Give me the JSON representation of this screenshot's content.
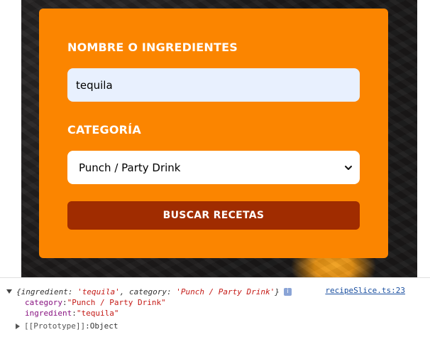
{
  "form": {
    "ingredient_label": "NOMBRE O INGREDIENTES",
    "ingredient_value": "tequila",
    "category_label": "CATEGORÍA",
    "category_selected": "Punch / Party Drink",
    "submit_label": "BUSCAR RECETAS"
  },
  "console": {
    "summary": {
      "open": "{",
      "k1": "ingredient",
      "colon1": ": ",
      "v1": "'tequila'",
      "comma": ", ",
      "k2": "category",
      "colon2": ": ",
      "v2": "'Punch / Party Drink'",
      "close": "}"
    },
    "info_icon": "i",
    "source": "recipeSlice.ts:23",
    "properties": [
      {
        "key": "category",
        "sep": ": ",
        "value": "\"Punch / Party Drink\""
      },
      {
        "key": "ingredient",
        "sep": ": ",
        "value": "\"tequila\""
      }
    ],
    "prototype_key": "[[Prototype]]",
    "prototype_sep": ": ",
    "prototype_value": "Object"
  },
  "colors": {
    "card": "#fb8500",
    "button": "#a02c00",
    "input_bg": "#e8f0fe"
  },
  "icons": {
    "select_arrow": "chevron-down-icon",
    "expand": "triangle-down-icon",
    "collapse": "triangle-right-icon",
    "info": "info-icon"
  }
}
